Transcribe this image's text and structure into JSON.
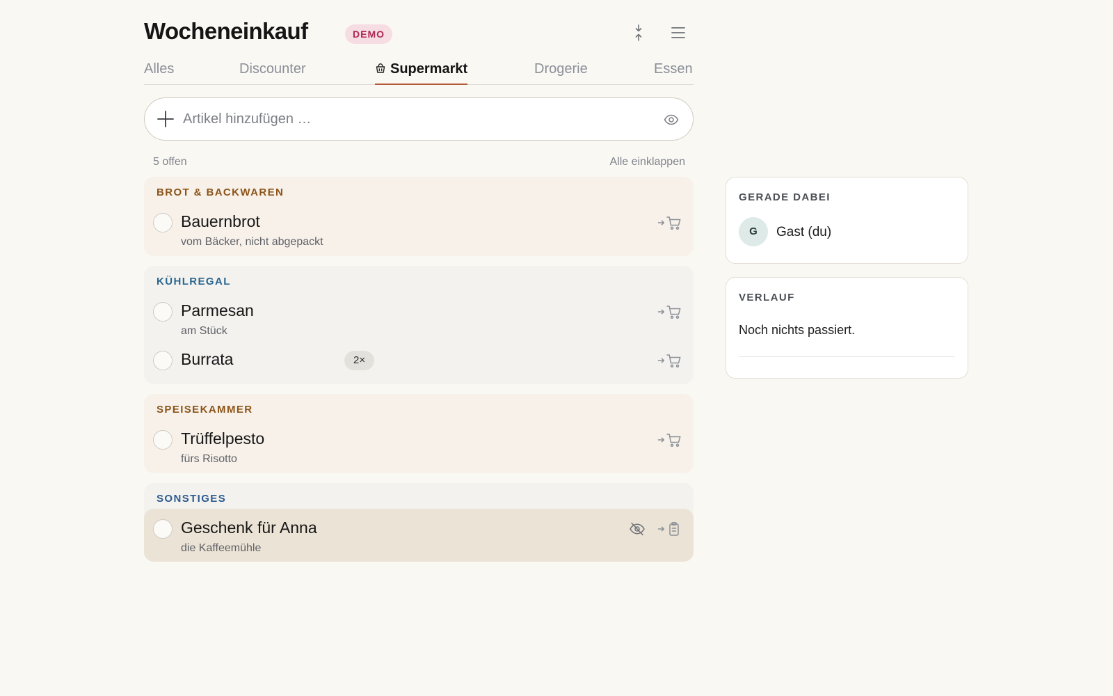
{
  "header": {
    "title": "Wocheneinkauf",
    "badge": "DEMO",
    "collapse_icon": "collapse-vertical-icon",
    "menu_icon": "hamburger-menu-icon"
  },
  "tabs": [
    {
      "label": "Alles",
      "active": false
    },
    {
      "label": "Discounter",
      "active": false
    },
    {
      "label": "Supermarkt",
      "active": true,
      "icon": "shopping-basket-icon"
    },
    {
      "label": "Drogerie",
      "active": false
    },
    {
      "label": "Essen",
      "active": false
    }
  ],
  "add_item": {
    "placeholder": "Artikel hinzufügen …",
    "value": ""
  },
  "status": {
    "open_count": "5 offen",
    "collapse_all": "Alle einklappen"
  },
  "groups": [
    {
      "title": "BROT & BACKWAREN",
      "title_color": "#8b5418",
      "items": [
        {
          "name": "Bauernbrot",
          "note": "vom Bäcker, nicht abgepackt",
          "action_icon": "cart-icon"
        }
      ]
    },
    {
      "title": "KÜHLREGAL",
      "title_color": "#2b6690",
      "items": [
        {
          "name": "Parmesan",
          "note": "am Stück",
          "action_icon": "cart-icon"
        },
        {
          "name": "Burrata",
          "quantity": "2×",
          "action_icon": "cart-icon"
        }
      ]
    },
    {
      "title": "SPEISEKAMMER",
      "title_color": "#8b5418",
      "items": [
        {
          "name": "Trüffelpesto",
          "note": "fürs Risotto",
          "action_icon": "cart-icon"
        }
      ]
    },
    {
      "title": "SONSTIGES",
      "title_color": "#2b5b8f",
      "items": [
        {
          "name": "Geschenk für Anna",
          "note": "die Kaffeemühle",
          "hidden": true,
          "action_icon": "clipboard-icon"
        }
      ]
    }
  ],
  "sidebar": {
    "presence": {
      "title": "GERADE DABEI",
      "users": [
        {
          "initial": "G",
          "name": "Gast (du)"
        }
      ]
    },
    "history": {
      "title": "VERLAUF",
      "empty_text": "Noch nichts passiert."
    }
  }
}
